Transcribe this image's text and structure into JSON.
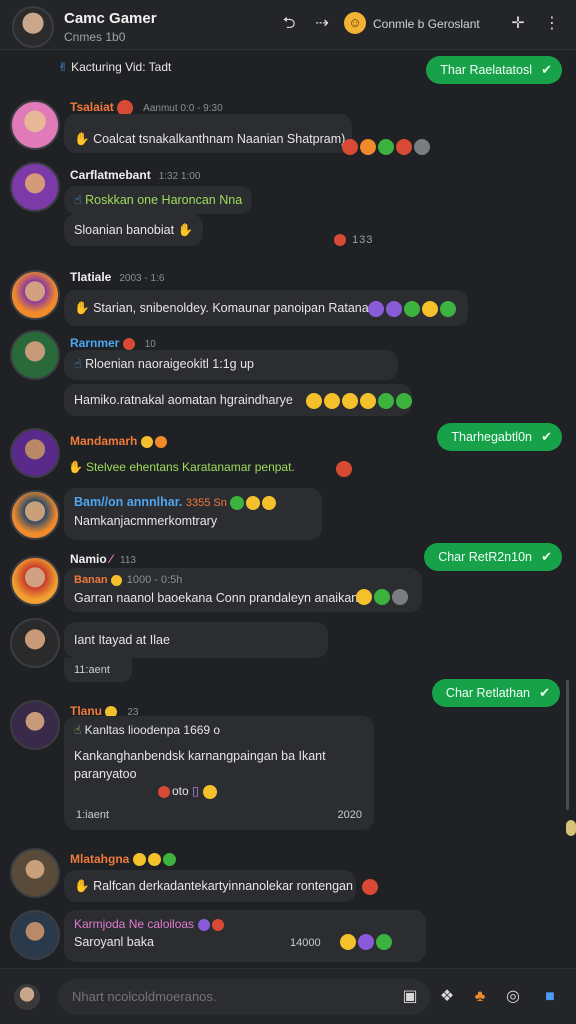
{
  "header": {
    "title": "Camc Gamer",
    "subtitle": "Cnmes 1b0",
    "status_text": "Conmle b Geroslant",
    "icons": [
      "share-icon",
      "export-icon",
      "emoji-badge-icon",
      "gamepad-icon",
      "more-vert-icon"
    ]
  },
  "messages": {
    "m0": {
      "reply": "Kacturing Vid: Tadt",
      "mine_text": "Thar Raelatatosl"
    },
    "m1": {
      "name": "Tsalaiat",
      "name_color": "#f07a3a",
      "meta": "Aanmut 0:0 - 9:30",
      "body": "Coalcat tsnakalkanthnam Naanian Shatpram)"
    },
    "m2": {
      "name": "Carflatmebant",
      "name_color": "#f0f0f0",
      "meta": "1:32 1:00",
      "reply": "Roskkan one Haroncan Nna",
      "body": "Sloanian banobiat",
      "count": "133"
    },
    "m3": {
      "name": "Tlatiale",
      "name_color": "#f0f0f0",
      "meta": "2003 - 1:6",
      "body": "Starian, snibenoldey. Komaunar panoipan Ratanar."
    },
    "m4": {
      "name": "Rarnmer",
      "name_color": "#4ea7f0",
      "meta": "10",
      "reply": "Rloenian naoraigeokitl 1:1g up",
      "body": "Hamiko.ratnakal aomatan hgraindharye"
    },
    "m5": {
      "name": "Mandamarh",
      "name_color": "#f07a3a",
      "reply": "Stelvee ehentans Karatanamar penpat.",
      "mine_text": "Tharhegabtl0n"
    },
    "m6": {
      "name": "Bam//on annnlhar.",
      "name_color": "#4ea7f0",
      "meta": "3355 Sn",
      "body": "Namkanjacmmerkomtrary"
    },
    "m7": {
      "name": "Namio",
      "name_color": "#f0f0f0",
      "meta": "113",
      "sub": "Banan",
      "submeta": "1000 - 0:5h",
      "body": "Garran naanol baoekana Conn prandaleyn anaikan.",
      "mine_text": "Char RetR2n10n"
    },
    "m8": {
      "body": "Iant Itayad at Ilae",
      "time": "11:aent"
    },
    "m9": {
      "name": "Tlanu",
      "name_color": "#f07a3a",
      "meta": "23",
      "reply": "Kanltas lioodenpa 1669 o",
      "body": "Kankanghanbendsk karnangpaingan ba Ikant paranyatoo",
      "body2": "oto",
      "time": "1:iaent",
      "count": "2020",
      "mine_text": "Char Retlathan"
    },
    "m10": {
      "name": "Mlatahgna",
      "name_color": "#f07a3a",
      "body": "Ralfcan derkadantekartyinnanolekar rontengan"
    },
    "m11": {
      "name": "Karmjoda Ne caloiloas",
      "name_color": "#e27bd0",
      "body": "Saroyanl baka",
      "time": "14000"
    }
  },
  "composer": {
    "placeholder": "Nhart ncolcoldmoeranos.",
    "icons": [
      "camera-icon",
      "game-icon",
      "gift-icon",
      "record-icon",
      "twitch-icon"
    ]
  },
  "colors": {
    "accent_green": "#17a24a",
    "bubble": "#2b2d31",
    "background": "#1f2124"
  }
}
